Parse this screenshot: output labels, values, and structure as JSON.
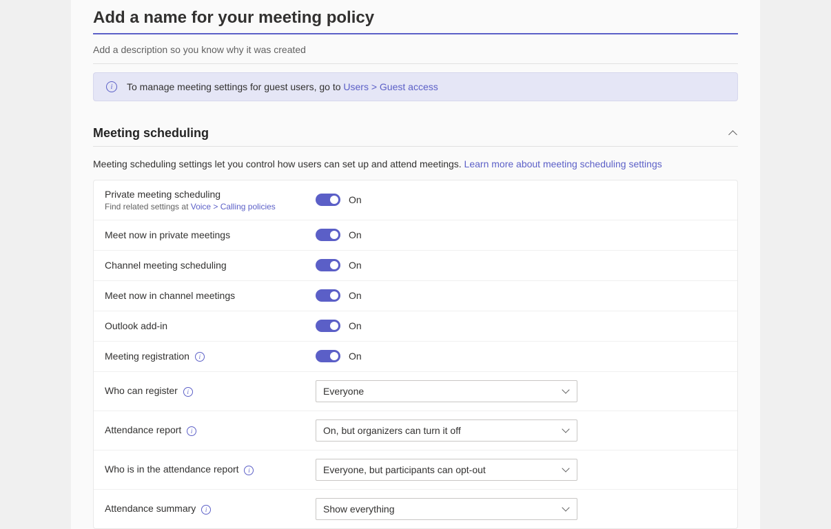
{
  "header": {
    "name_placeholder": "Add a name for your meeting policy",
    "desc_placeholder": "Add a description so you know why it was created"
  },
  "banner": {
    "text": "To manage meeting settings for guest users, go to ",
    "link": "Users > Guest access"
  },
  "section": {
    "title": "Meeting scheduling",
    "desc_text": "Meeting scheduling settings let you control how users can set up and attend meetings. ",
    "desc_link": "Learn more about meeting scheduling settings"
  },
  "settings": {
    "private_meeting": {
      "label": "Private meeting scheduling",
      "sub_prefix": "Find related settings at ",
      "sub_link": "Voice > Calling policies",
      "state": "On"
    },
    "meet_now_private": {
      "label": "Meet now in private meetings",
      "state": "On"
    },
    "channel_scheduling": {
      "label": "Channel meeting scheduling",
      "state": "On"
    },
    "meet_now_channel": {
      "label": "Meet now in channel meetings",
      "state": "On"
    },
    "outlook_addin": {
      "label": "Outlook add-in",
      "state": "On"
    },
    "meeting_registration": {
      "label": "Meeting registration",
      "state": "On"
    },
    "who_can_register": {
      "label": "Who can register",
      "value": "Everyone"
    },
    "attendance_report": {
      "label": "Attendance report",
      "value": "On, but organizers can turn it off"
    },
    "who_in_report": {
      "label": "Who is in the attendance report",
      "value": "Everyone, but participants can opt-out"
    },
    "attendance_summary": {
      "label": "Attendance summary",
      "value": "Show everything"
    }
  }
}
